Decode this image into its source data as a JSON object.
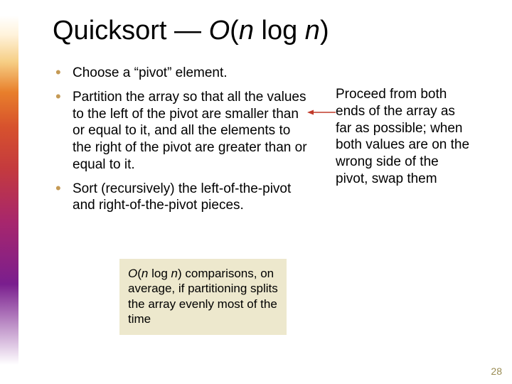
{
  "title": {
    "plain1": "Quicksort — ",
    "bigO_open": "O",
    "paren_open": "(",
    "n1": "n",
    "mid": " log ",
    "n2": "n",
    "paren_close": ")"
  },
  "bullets": [
    "Choose a “pivot” element.",
    "Partition the array so that all the values to the left of the pivot are smaller than or equal to it, and all the elements to the right of the pivot are greater than or equal to it.",
    "Sort (recursively) the left-of-the-pivot and right-of-the-pivot pieces."
  ],
  "side_note": "Proceed from both ends of the array as far as possible; when both values are on the wrong side of the pivot, swap them",
  "bottom_box": {
    "bigO_open": "O",
    "paren_open": "(",
    "n1": "n",
    "mid": " log ",
    "n2": "n",
    "paren_close": ")",
    "rest": " comparisons, on average, if partitioning splits the array evenly most of the time"
  },
  "page_number": "28",
  "colors": {
    "bullet": "#c59a55",
    "arrow": "#c13a2a",
    "box_bg": "#ede8cd"
  }
}
